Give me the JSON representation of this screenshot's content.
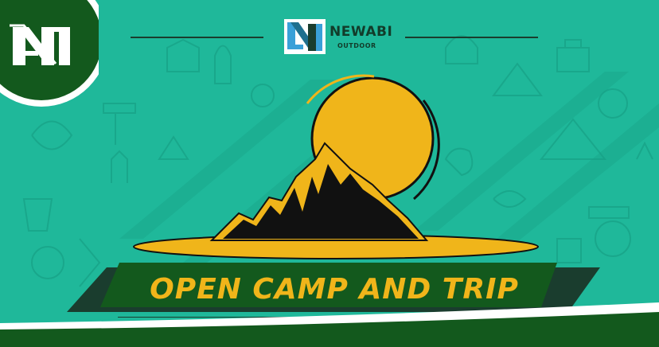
{
  "brand": {
    "name": "NEWABI",
    "subtitle": "OUTDOOR"
  },
  "banner": {
    "headline": "OPEN CAMP AND TRIP"
  },
  "icons": {
    "corner_logo": "newabi-n-logo-icon",
    "brand_logo": "newabi-n-logo-icon",
    "sun": "sun-icon",
    "mountain": "mountain-icon",
    "background_doodles": "camping-doodle-icons"
  },
  "colors": {
    "background": "#1fb89a",
    "dark_green": "#13591d",
    "gold": "#f0b51a",
    "black": "#111111",
    "white": "#ffffff"
  }
}
